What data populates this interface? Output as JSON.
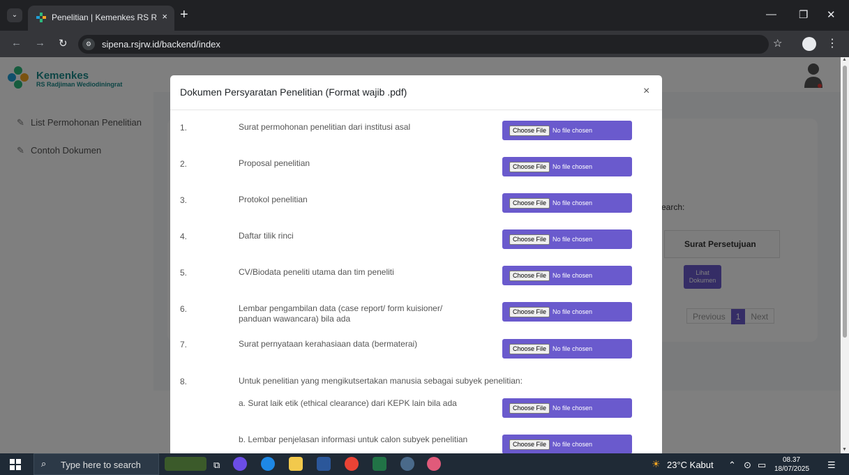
{
  "browser": {
    "tab_title": "Penelitian | Kemenkes RS Radjiman",
    "tab_close": "×",
    "new_tab": "+",
    "url": "sipena.rsjrw.id/backend/index",
    "icons": [
      "favicon-icon",
      "back-icon",
      "forward-icon",
      "reload-icon",
      "site-info-icon",
      "bookmark-star-icon",
      "profile-icon",
      "menu-icon"
    ]
  },
  "window_controls": {
    "minimize": "—",
    "restore": "❐",
    "close": "✕"
  },
  "sidebar": {
    "logo_title": "Kemenkes",
    "logo_subtitle": "RS Radjiman Wediodiningrat",
    "items": [
      {
        "label": "List Permohonan Penelitian",
        "icon": "edit-icon"
      },
      {
        "label": "Contoh Dokumen",
        "icon": "edit-icon"
      }
    ]
  },
  "background_page": {
    "search_label": "earch:",
    "column_header": "Surat Persetujuan",
    "view_button": "Lihat Dokumen",
    "pagination": {
      "previous": "Previous",
      "current": "1",
      "next": "Next"
    }
  },
  "modal": {
    "title": "Dokumen Persyaratan Penelitian (Format wajib .pdf)",
    "close": "×",
    "file_button": "Choose File",
    "file_status": "No file chosen",
    "rows": [
      {
        "num": "1.",
        "label": "Surat permohonan penelitian dari institusi asal"
      },
      {
        "num": "2.",
        "label": "Proposal penelitian"
      },
      {
        "num": "3.",
        "label": "Protokol penelitian"
      },
      {
        "num": "4.",
        "label": "Daftar tilik rinci"
      },
      {
        "num": "5.",
        "label": "CV/Biodata peneliti utama dan tim peneliti"
      },
      {
        "num": "6.",
        "label": "Lembar pengambilan data (case report/ form kuisioner/ panduan wawancara) bila ada"
      },
      {
        "num": "7.",
        "label": "Surat pernyataan kerahasiaan data (bermaterai)"
      }
    ],
    "row8": {
      "num": "8.",
      "label": "Untuk penelitian yang mengikutsertakan manusia sebagai subyek penelitian:",
      "sub": [
        "a. Surat laik etik (ethical clearance) dari KEPK lain bila ada",
        "b. Lembar penjelasan informasi untuk calon subyek penelitian"
      ]
    }
  },
  "taskbar": {
    "search_placeholder": "Type here to search",
    "weather": "23°C  Kabut",
    "time": "08.37",
    "date": "18/07/2025"
  },
  "colors": {
    "accent": "#6a5acd",
    "teal": "#1a8a8a"
  }
}
